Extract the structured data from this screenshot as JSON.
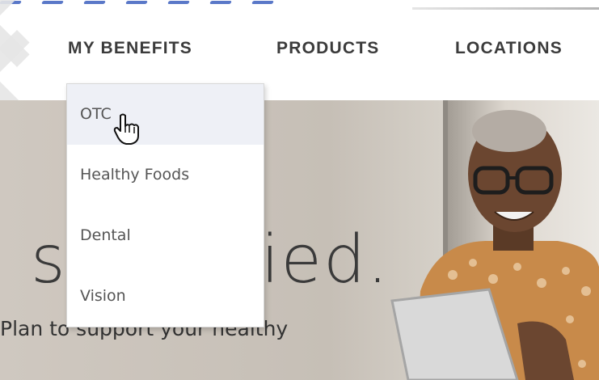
{
  "nav": {
    "items": [
      {
        "label": "MY BENEFITS"
      },
      {
        "label": "PRODUCTS"
      },
      {
        "label": "LOCATIONS"
      }
    ],
    "active_index": 0
  },
  "dropdown": {
    "items": [
      {
        "label": "OTC"
      },
      {
        "label": "Healthy Foods"
      },
      {
        "label": "Dental"
      },
      {
        "label": "Vision"
      }
    ],
    "hovered_index": 0
  },
  "hero": {
    "title_left": "s",
    "title_right": "ied.",
    "subtitle_left": "Plan to support your",
    "subtitle_right": "healthy"
  },
  "colors": {
    "accent": "#1c3c86",
    "nav_text": "#3b3b3b"
  },
  "icons": {
    "cursor": "hand-pointer-icon"
  }
}
